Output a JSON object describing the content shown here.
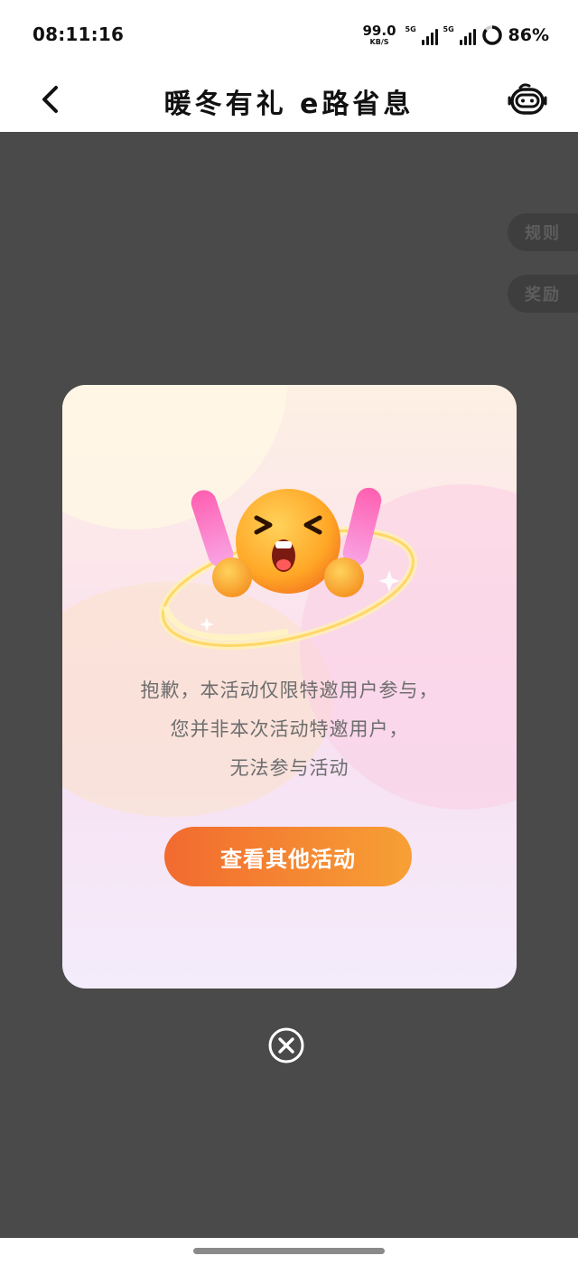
{
  "status_bar": {
    "time": "08:11:16",
    "net_speed_value": "99.0",
    "net_speed_unit": "KB/S",
    "sim1_tag": "5G",
    "sim2_tag": "5G",
    "battery": "86%",
    "battery_level": 0.86
  },
  "header": {
    "title": "暖冬有礼 e路省息",
    "back_icon": "chevron-left-icon",
    "assistant_icon": "robot-assistant-icon"
  },
  "side_buttons": {
    "rules": "规则",
    "rewards": "奖励"
  },
  "dialog": {
    "illustration": "upset-emoji-with-exclamation-marks",
    "message_lines": [
      "抱歉，本活动仅限特邀用户参与，",
      "您并非本次活动特邀用户，",
      "无法参与活动"
    ],
    "cta_label": "查看其他活动",
    "close_icon": "circle-close-icon"
  },
  "colors": {
    "overlay": "#4a4a4a",
    "cta_start": "#f26a2f",
    "cta_end": "#f7a035"
  }
}
